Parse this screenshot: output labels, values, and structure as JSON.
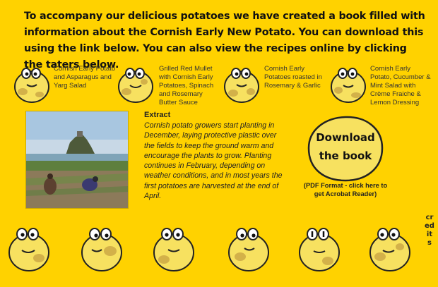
{
  "intro": {
    "text": "To accompany our delicious potatoes we have created a book filled with information about the Cornish Early New Potato. You can download this using the link below. You can also view the recipes online by clicking the taters below."
  },
  "recipes": [
    {
      "label": "Cornish Early Potato and Asparagus and Yarg Salad"
    },
    {
      "label": "Grilled Red Mullet with Cornish Early Potatoes, Spinach and Rosemary Butter Sauce"
    },
    {
      "label": "Cornish Early Potatoes roasted in Rosemary & Garlic"
    },
    {
      "label": "Cornish Early Potato, Cucumber & Mint Salad with Crème Fraiche & Lemon Dressing"
    }
  ],
  "extract": {
    "title": "Extract",
    "body": "Cornish potato growers start planting in December, laying protective plastic over the fields to keep the ground warm and encourage the plants to grow. Planting continues in February, depending on weather conditions, and in most years the first potatoes are harvested at the end of April."
  },
  "download": {
    "line1": "Download",
    "line2": "the book",
    "note": "(PDF Format - click here to get Acrobat Reader)"
  },
  "credits": {
    "label": "credits"
  },
  "colors": {
    "background": "#FFD200",
    "tater": "#F7E160",
    "spot": "#C9A544"
  }
}
